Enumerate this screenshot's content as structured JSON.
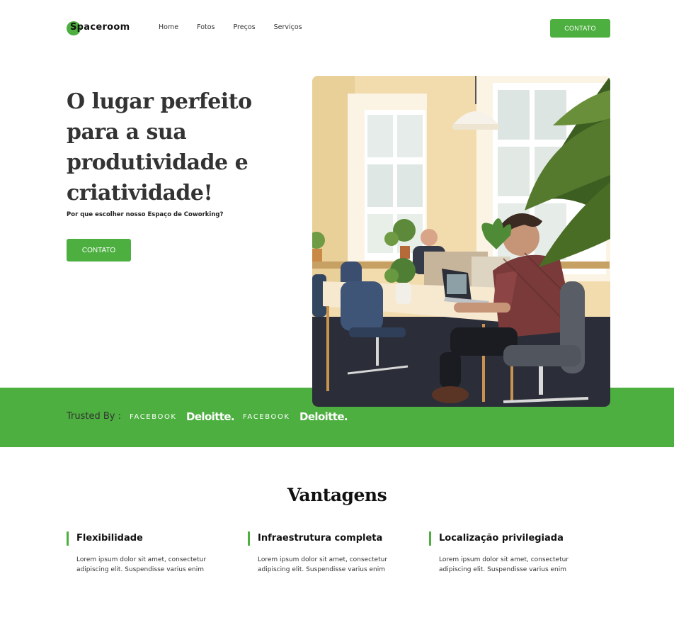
{
  "brand": {
    "name": "Spaceroom",
    "accent_color": "#4caf3f"
  },
  "nav": {
    "links": [
      "Home",
      "Fotos",
      "Preços",
      "Serviços"
    ],
    "cta_label": "CONTATO"
  },
  "hero": {
    "title": "O lugar perfeito para a sua produtividade e criatividade!",
    "subtitle": "Por que escolher nosso Espaço de Coworking?",
    "cta_label": "CONTATO",
    "image": "coworking-office-photo"
  },
  "trusted": {
    "label": "Trusted By :",
    "logos": [
      "FACEBOOK",
      "Deloitte.",
      "FACEBOOK",
      "Deloitte."
    ]
  },
  "advantages": {
    "title": "Vantagens",
    "items": [
      {
        "title": "Flexibilidade",
        "text": "Lorem ipsum dolor sit amet, consectetur adipiscing elit. Suspendisse varius enim"
      },
      {
        "title": "Infraestrutura completa",
        "text": "Lorem ipsum dolor sit amet, consectetur adipiscing elit. Suspendisse varius enim"
      },
      {
        "title": "Localização privilegiada",
        "text": "Lorem ipsum dolor sit amet, consectetur adipiscing elit. Suspendisse varius enim"
      }
    ]
  }
}
